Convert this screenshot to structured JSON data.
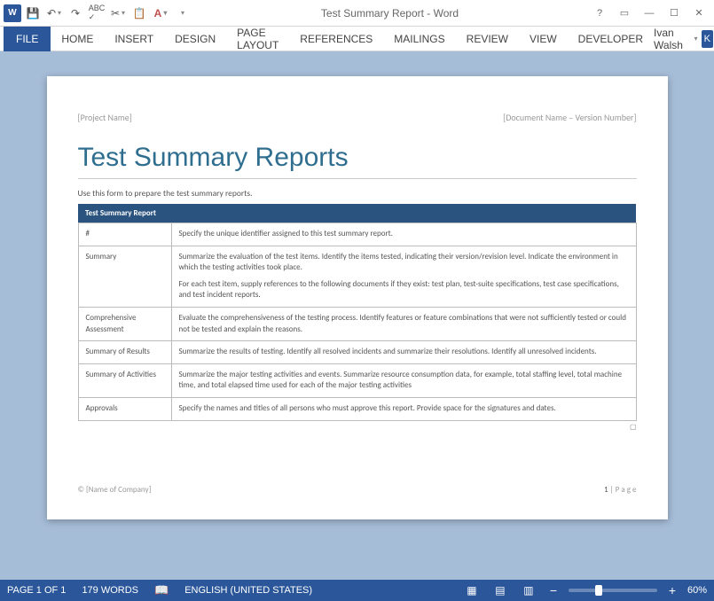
{
  "titlebar": {
    "app_icon_text": "W",
    "title": "Test Summary Report - Word"
  },
  "ribbon": {
    "file": "FILE",
    "tabs": [
      "HOME",
      "INSERT",
      "DESIGN",
      "PAGE LAYOUT",
      "REFERENCES",
      "MAILINGS",
      "REVIEW",
      "VIEW",
      "DEVELOPER"
    ],
    "user_name": "Ivan Walsh",
    "user_initial": "K"
  },
  "document": {
    "header_left": "[Project Name]",
    "header_right": "[Document Name – Version Number]",
    "title": "Test Summary Reports",
    "intro": "Use this form to prepare the test summary reports.",
    "table_header": "Test Summary Report",
    "rows": [
      {
        "label": "#",
        "paras": [
          "Specify the unique identifier assigned to this test summary report."
        ]
      },
      {
        "label": "Summary",
        "paras": [
          "Summarize the evaluation of the test items. Identify the items tested, indicating their version/revision level. Indicate the environment in which the testing activities took place.",
          "For each test item, supply references to the following documents if they exist: test plan, test-suite specifications, test case specifications, and test incident reports."
        ]
      },
      {
        "label": "Comprehensive Assessment",
        "paras": [
          "Evaluate the comprehensiveness of the testing process. Identify features or feature combinations that were not sufficiently tested or could not be tested and explain the reasons."
        ]
      },
      {
        "label": "Summary of Results",
        "paras": [
          "Summarize the results of testing. Identify all resolved incidents and summarize their resolutions. Identify all unresolved incidents."
        ]
      },
      {
        "label": "Summary of Activities",
        "paras": [
          "Summarize the major testing activities and events. Summarize resource consumption data, for example, total staffing level, total machine time, and total elapsed time used for each of the major testing activities"
        ]
      },
      {
        "label": "Approvals",
        "paras": [
          "Specify the names and titles of all persons who must approve this report. Provide space for the signatures and dates."
        ]
      }
    ],
    "footer_left": "© [Name of Company]",
    "footer_page_num": "1",
    "footer_page_text": " | P a g e"
  },
  "statusbar": {
    "page": "PAGE 1 OF 1",
    "words": "179 WORDS",
    "language": "ENGLISH (UNITED STATES)",
    "zoom": "60%",
    "zoom_pct": 60
  }
}
